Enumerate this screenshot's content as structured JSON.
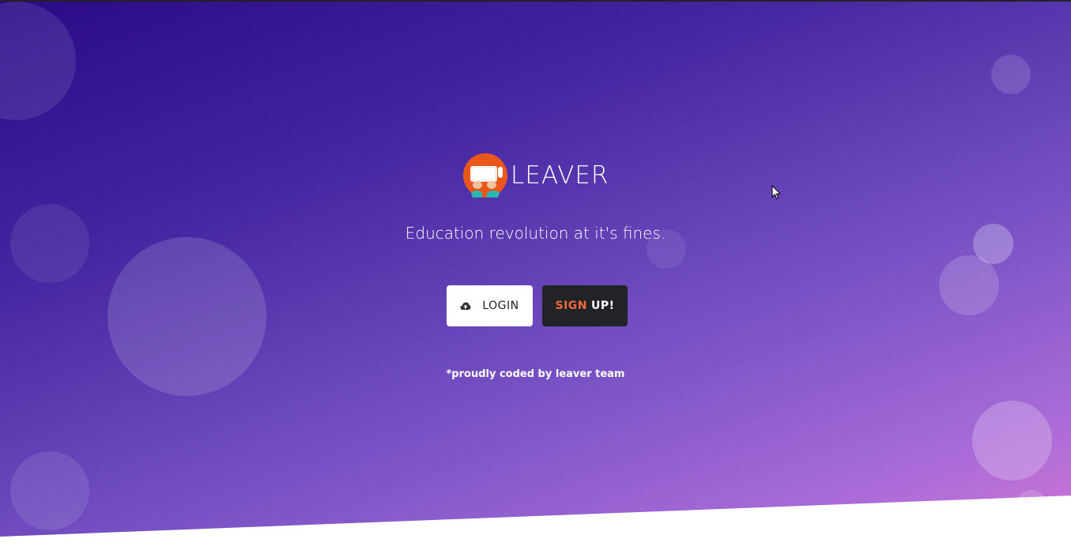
{
  "brand": {
    "name": "LEAVER",
    "logo_icon": "typing-hands-logo-icon"
  },
  "hero": {
    "tagline": "Education revolution at it's fines.",
    "credit": "*proudly coded by leaver team"
  },
  "actions": {
    "login_label": "LOGIN",
    "login_icon": "cloud-upload-icon",
    "signup_part1": "SIGN",
    "signup_part2": "UP!"
  },
  "colors": {
    "gradient_start": "#2a0a86",
    "gradient_end": "#d377d6",
    "signup_accent": "#ef6a3b",
    "signup_bg": "#222327",
    "logo_orange": "#e9571a"
  }
}
